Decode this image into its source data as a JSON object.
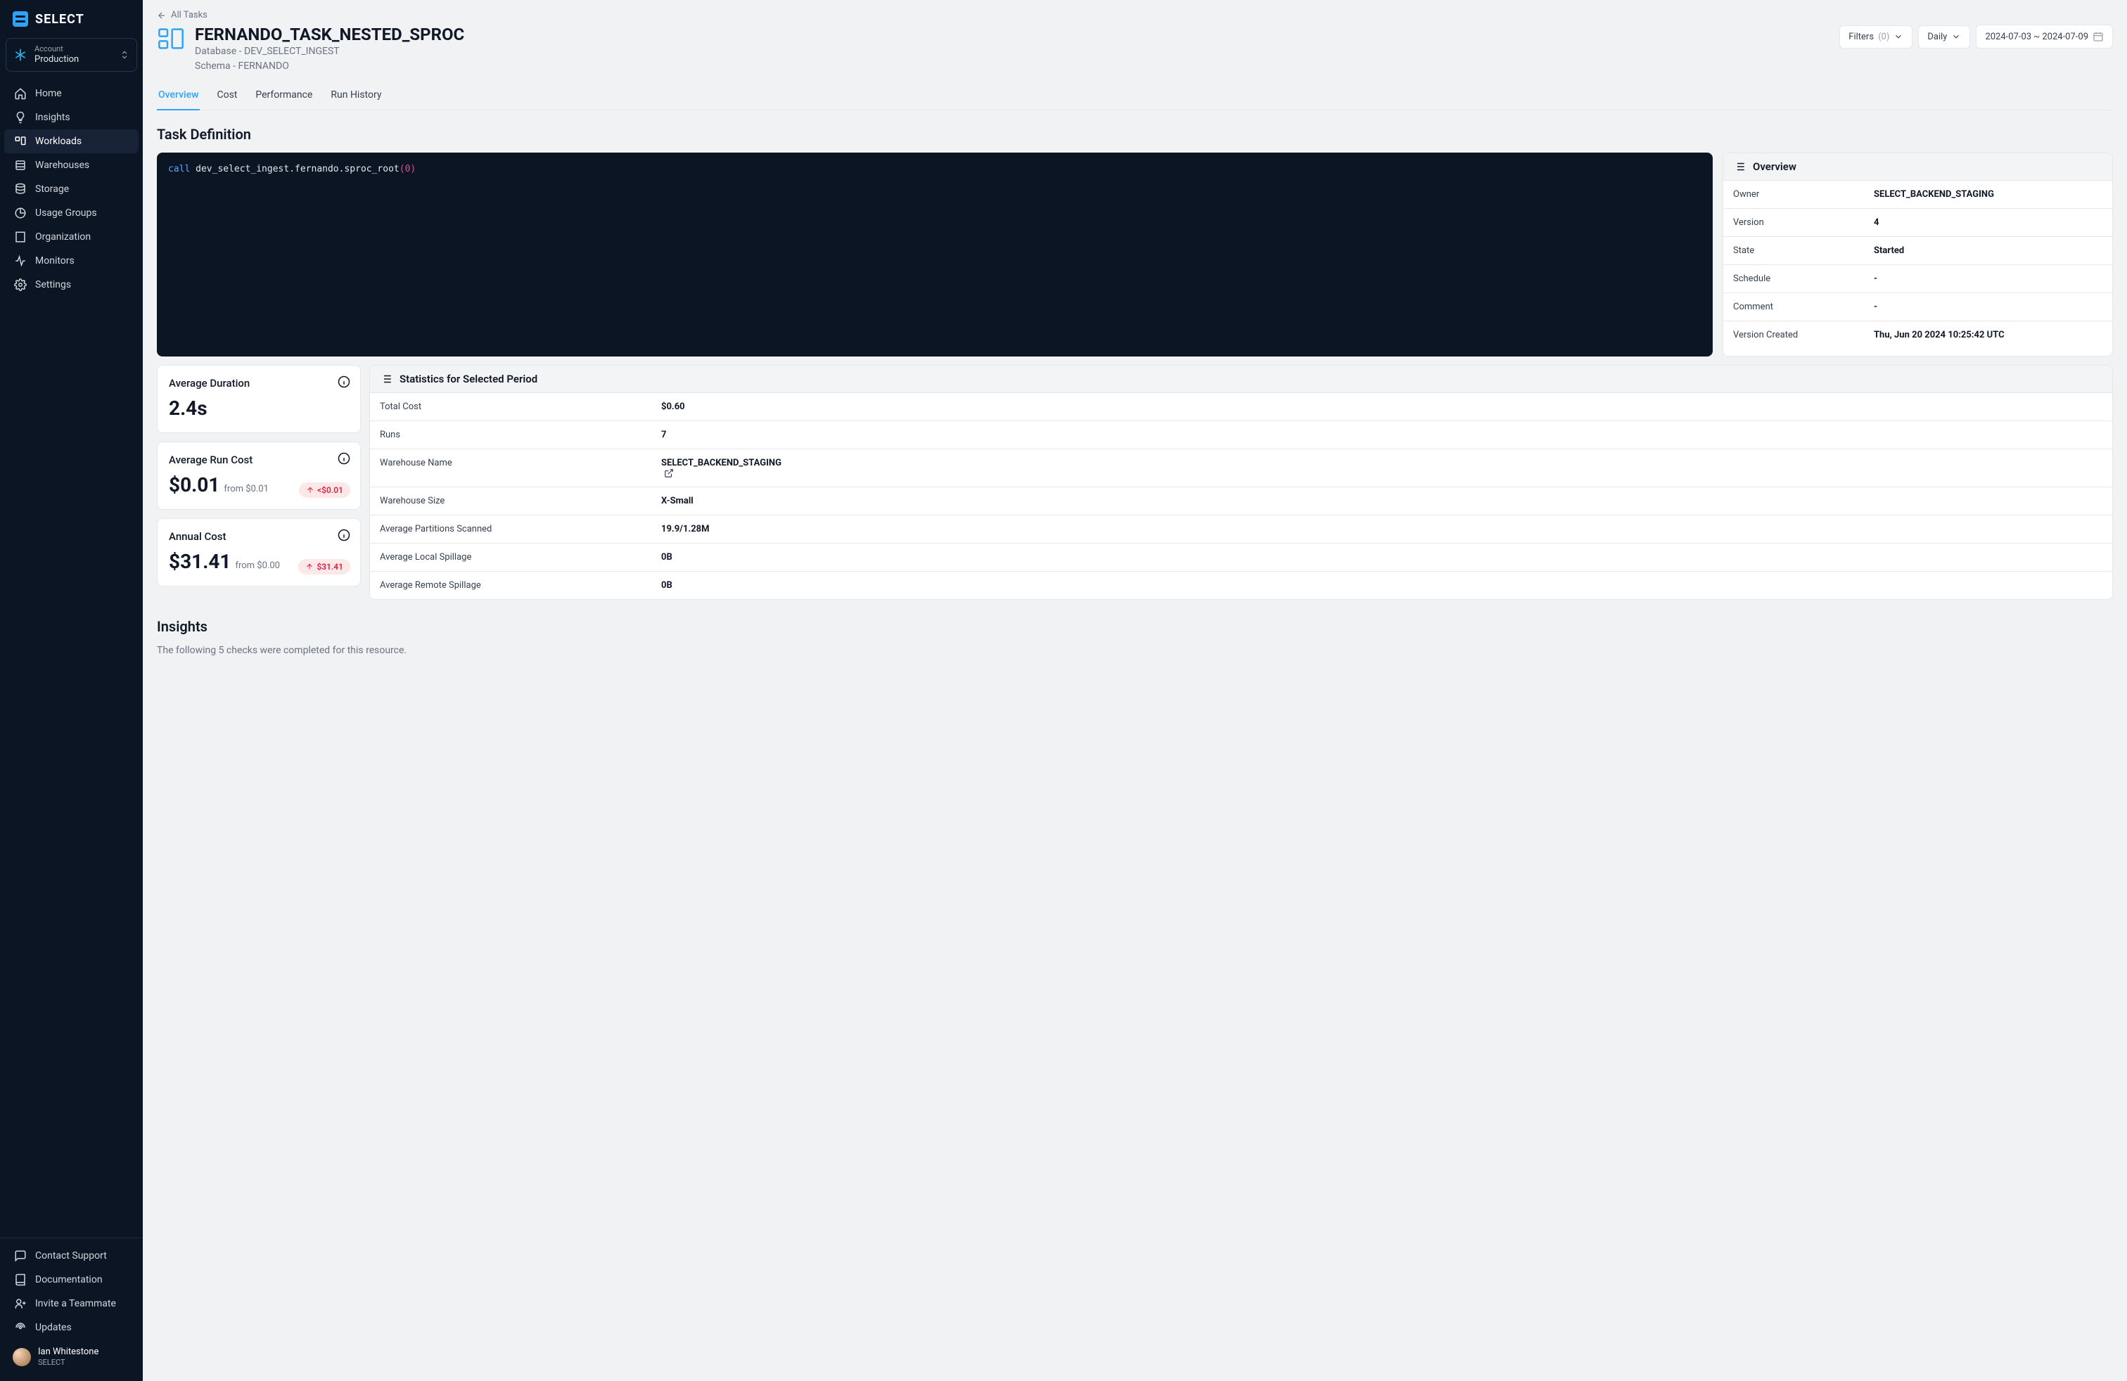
{
  "sidebar": {
    "logo_text": "SELECT",
    "account_label": "Account",
    "account_value": "Production",
    "nav": [
      {
        "label": "Home"
      },
      {
        "label": "Insights"
      },
      {
        "label": "Workloads"
      },
      {
        "label": "Warehouses"
      },
      {
        "label": "Storage"
      },
      {
        "label": "Usage Groups"
      },
      {
        "label": "Organization"
      },
      {
        "label": "Monitors"
      },
      {
        "label": "Settings"
      }
    ],
    "bottom": [
      {
        "label": "Contact Support"
      },
      {
        "label": "Documentation"
      },
      {
        "label": "Invite a Teammate"
      },
      {
        "label": "Updates"
      }
    ],
    "user_name": "Ian Whitestone",
    "user_org": "SELECT"
  },
  "breadcrumb": {
    "all_tasks": "All Tasks"
  },
  "header": {
    "title": "FERNANDO_TASK_NESTED_SPROC",
    "database_prefix": "Database - ",
    "database": "DEV_SELECT_INGEST",
    "schema_prefix": "Schema - ",
    "schema": "FERNANDO",
    "filters_label": "Filters",
    "filters_count": "(0)",
    "granularity": "Daily",
    "date_range": "2024-07-03 ~ 2024-07-09"
  },
  "tabs": [
    "Overview",
    "Cost",
    "Performance",
    "Run History"
  ],
  "task_definition_label": "Task Definition",
  "code": {
    "call": "call",
    "ident": "dev_select_ingest.fernando.sproc_root",
    "arg": "0"
  },
  "overview_panel": {
    "title": "Overview",
    "rows": [
      {
        "k": "Owner",
        "v": "SELECT_BACKEND_STAGING"
      },
      {
        "k": "Version",
        "v": "4"
      },
      {
        "k": "State",
        "v": "Started"
      },
      {
        "k": "Schedule",
        "v": "-"
      },
      {
        "k": "Comment",
        "v": "-"
      },
      {
        "k": "Version Created",
        "v": "Thu, Jun 20 2024 10:25:42 UTC"
      }
    ]
  },
  "metrics": {
    "avg_duration": {
      "label": "Average Duration",
      "value": "2.4s"
    },
    "avg_run_cost": {
      "label": "Average Run Cost",
      "value": "$0.01",
      "from": "from $0.01",
      "delta": "<$0.01"
    },
    "annual_cost": {
      "label": "Annual Cost",
      "value": "$31.41",
      "from": "from $0.00",
      "delta": "$31.41"
    }
  },
  "stats_panel": {
    "title": "Statistics for Selected Period",
    "rows": [
      {
        "k": "Total Cost",
        "v": "$0.60"
      },
      {
        "k": "Runs",
        "v": "7"
      },
      {
        "k": "Warehouse Name",
        "v": "SELECT_BACKEND_STAGING",
        "link": true
      },
      {
        "k": "Warehouse Size",
        "v": "X-Small"
      },
      {
        "k": "Average Partitions Scanned",
        "v": "19.9/1.28M"
      },
      {
        "k": "Average Local Spillage",
        "v": "0B"
      },
      {
        "k": "Average Remote Spillage",
        "v": "0B"
      }
    ]
  },
  "insights": {
    "title": "Insights",
    "subtitle": "The following 5 checks were completed for this resource."
  }
}
